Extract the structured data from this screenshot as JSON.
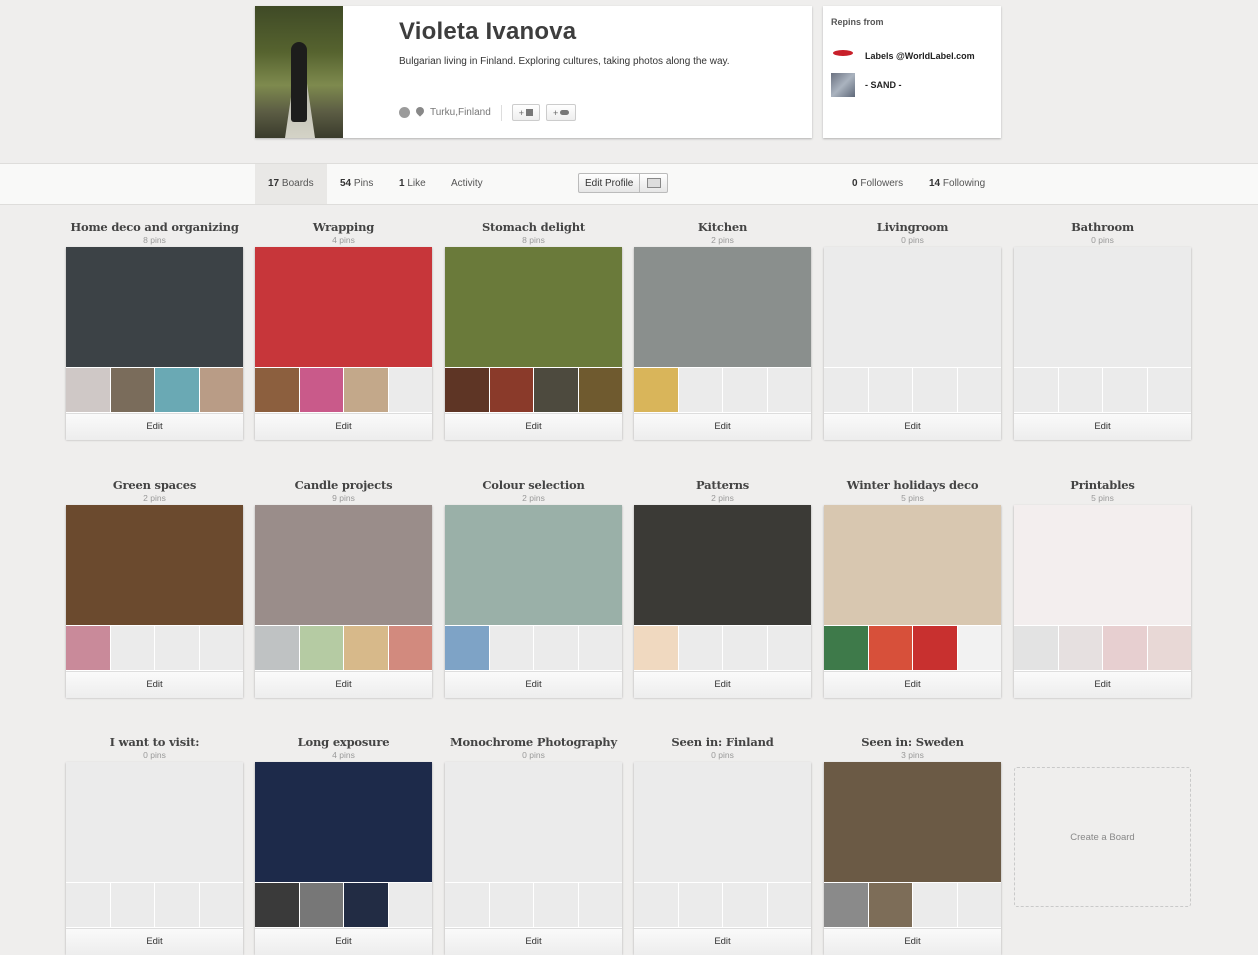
{
  "profile": {
    "name": "Violeta Ivanova",
    "bio": "Bulgarian living in Finland. Exploring cultures, taking photos along the way.",
    "location": "Turku,Finland",
    "facebook_btn": "+",
    "twitter_btn": "+"
  },
  "repins": {
    "title": "Repins from",
    "items": [
      {
        "name": "Labels @WorldLabel.com"
      },
      {
        "name": "- SAND -"
      }
    ]
  },
  "tabs": {
    "boards": {
      "count": "17",
      "label": "Boards"
    },
    "pins": {
      "count": "54",
      "label": "Pins"
    },
    "likes": {
      "count": "1",
      "label": "Like"
    },
    "activity": "Activity",
    "edit_profile": "Edit Profile",
    "followers": {
      "count": "0",
      "label": "Followers"
    },
    "following": {
      "count": "14",
      "label": "Following"
    }
  },
  "boards": [
    {
      "title": "Home deco and organizing",
      "count": "8 pins",
      "edit": "Edit",
      "main_color": "#3c4246",
      "thumbs": [
        "#cfc8c6",
        "#7a6c5b",
        "#6aa9b4",
        "#b99c86"
      ]
    },
    {
      "title": "Wrapping",
      "count": "4 pins",
      "edit": "Edit",
      "main_color": "#c7363a",
      "thumbs": [
        "#8c5f3e",
        "#c95a8a",
        "#c3a88a",
        "#ebebeb"
      ]
    },
    {
      "title": "Stomach delight",
      "count": "8 pins",
      "edit": "Edit",
      "main_color": "#6a7a3a",
      "thumbs": [
        "#5e3525",
        "#8a3a2a",
        "#4d4a3e",
        "#6f5a2f"
      ]
    },
    {
      "title": "Kitchen",
      "count": "2 pins",
      "edit": "Edit",
      "main_color": "#8a8f8d",
      "thumbs": [
        "#d9b55a",
        "#ebebeb",
        "#ebebeb",
        "#ebebeb"
      ]
    },
    {
      "title": "Livingroom",
      "count": "0 pins",
      "edit": "Edit",
      "main_color": "#ebebeb",
      "thumbs": [
        "#ebebeb",
        "#ebebeb",
        "#ebebeb",
        "#ebebeb"
      ]
    },
    {
      "title": "Bathroom",
      "count": "0 pins",
      "edit": "Edit",
      "main_color": "#ebebeb",
      "thumbs": [
        "#ebebeb",
        "#ebebeb",
        "#ebebeb",
        "#ebebeb"
      ]
    },
    {
      "title": "Green spaces",
      "count": "2 pins",
      "edit": "Edit",
      "main_color": "#6b4a2e",
      "thumbs": [
        "#c98a9a",
        "#ebebeb",
        "#ebebeb",
        "#ebebeb"
      ]
    },
    {
      "title": "Candle projects",
      "count": "9 pins",
      "edit": "Edit",
      "main_color": "#9a8d8a",
      "thumbs": [
        "#bfc2c3",
        "#b5cba3",
        "#d7b98a",
        "#d28a7e"
      ]
    },
    {
      "title": "Colour selection",
      "count": "2 pins",
      "edit": "Edit",
      "main_color": "#9ab0a8",
      "thumbs": [
        "#7ea3c6",
        "#ebebeb",
        "#ebebeb",
        "#ebebeb"
      ]
    },
    {
      "title": "Patterns",
      "count": "2 pins",
      "edit": "Edit",
      "main_color": "#3b3a36",
      "thumbs": [
        "#f0d9c0",
        "#ebebeb",
        "#ebebeb",
        "#ebebeb"
      ]
    },
    {
      "title": "Winter holidays deco",
      "count": "5 pins",
      "edit": "Edit",
      "main_color": "#d8c7b0",
      "thumbs": [
        "#3e7a4a",
        "#d7503a",
        "#c8302f",
        "#f2f2f2"
      ]
    },
    {
      "title": "Printables",
      "count": "5 pins",
      "edit": "Edit",
      "main_color": "#f3eeee",
      "thumbs": [
        "#e3e3e3",
        "#e6e0e0",
        "#e7cfd0",
        "#e8d8d6"
      ]
    },
    {
      "title": "I want to visit:",
      "count": "0 pins",
      "edit": "Edit",
      "main_color": "#ebebeb",
      "thumbs": [
        "#ebebeb",
        "#ebebeb",
        "#ebebeb",
        "#ebebeb"
      ]
    },
    {
      "title": "Long exposure",
      "count": "4 pins",
      "edit": "Edit",
      "main_color": "#1d2a4a",
      "thumbs": [
        "#3a3a3a",
        "#777777",
        "#222c44",
        "#ebebeb"
      ]
    },
    {
      "title": "Monochrome Photography",
      "count": "0 pins",
      "edit": "Edit",
      "main_color": "#ebebeb",
      "thumbs": [
        "#ebebeb",
        "#ebebeb",
        "#ebebeb",
        "#ebebeb"
      ]
    },
    {
      "title": "Seen in: Finland",
      "count": "0 pins",
      "edit": "Edit",
      "main_color": "#ebebeb",
      "thumbs": [
        "#ebebeb",
        "#ebebeb",
        "#ebebeb",
        "#ebebeb"
      ]
    },
    {
      "title": "Seen in: Sweden",
      "count": "3 pins",
      "edit": "Edit",
      "main_color": "#6b5a45",
      "thumbs": [
        "#8a8a8a",
        "#7d6d58",
        "#ebebeb",
        "#ebebeb"
      ]
    }
  ],
  "create_board": "Create a Board",
  "colors": {
    "page_bg": "#efeeed",
    "card_bg": "#ffffff",
    "placeholder": "#ebebeb"
  }
}
